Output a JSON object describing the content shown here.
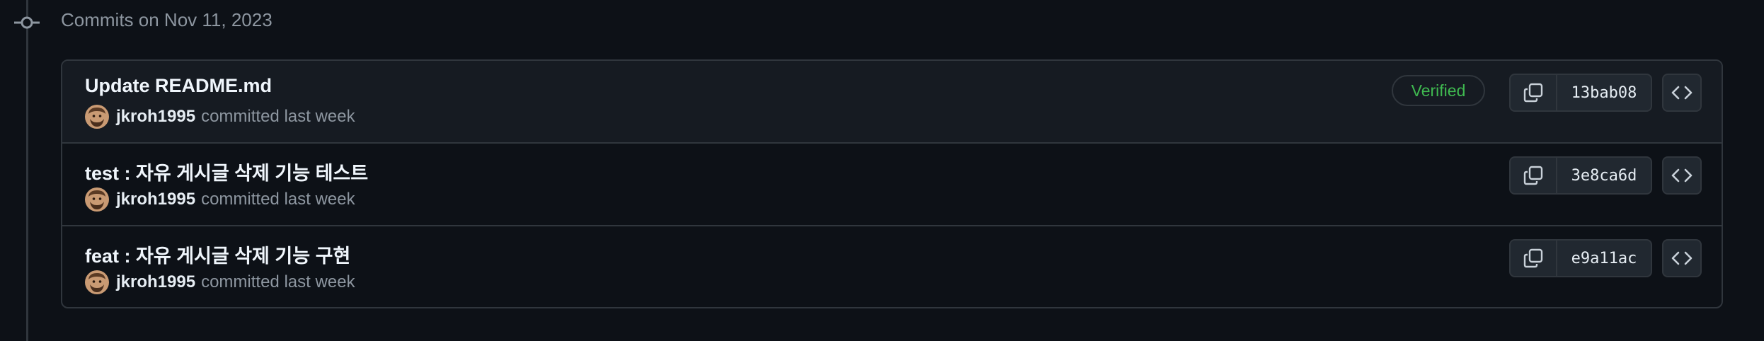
{
  "commit_group": {
    "title": "Commits on Nov 11, 2023"
  },
  "commits": [
    {
      "message": "Update README.md",
      "author": "jkroh1995",
      "meta": "committed last week",
      "verified": "Verified",
      "sha": "13bab08"
    },
    {
      "message": "test : 자유 게시글 삭제 기능 테스트",
      "author": "jkroh1995",
      "meta": "committed last week",
      "sha": "3e8ca6d"
    },
    {
      "message": "feat : 자유 게시글 삭제 기능 구현",
      "author": "jkroh1995",
      "meta": "committed last week",
      "sha": "e9a11ac"
    }
  ],
  "icons": {
    "timeline": "git-commit-icon",
    "copy": "copy-icon",
    "browse": "code-icon",
    "avatar": "avatar-icon"
  },
  "colors": {
    "background": "#0d1117",
    "border": "#30363d",
    "verified": "#3fb950",
    "muted_text": "#8d96a0"
  }
}
